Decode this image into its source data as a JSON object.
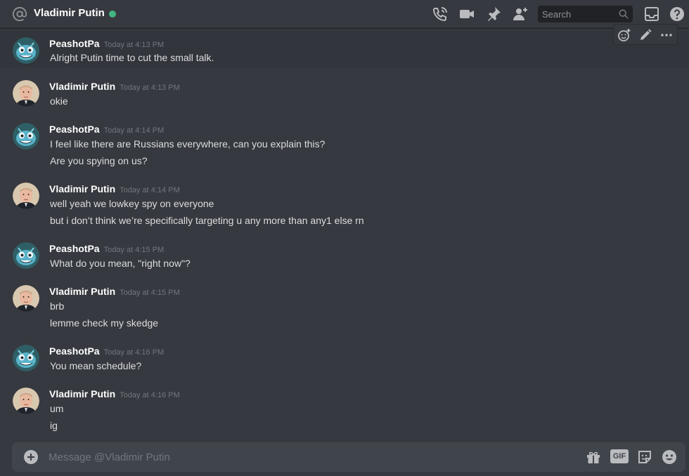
{
  "header": {
    "title": "Vladimir Putin",
    "status": "online",
    "search_placeholder": "Search",
    "icons": [
      "at-icon",
      "call-icon",
      "video-icon",
      "pin-icon",
      "add-friend-icon",
      "search-icon",
      "inbox-icon",
      "help-icon"
    ]
  },
  "colors": {
    "background": "#36393f",
    "online": "#43b581",
    "composer": "#40444b",
    "search": "#202225"
  },
  "hover_toolbar": {
    "icons": [
      "add-reaction-icon",
      "edit-icon",
      "more-icon"
    ]
  },
  "messages": [
    {
      "author": "PeashotPa",
      "avatar": "peashot-avatar",
      "time": "Today at 4:13 PM",
      "lines": [
        "Alright Putin time to cut the small talk."
      ]
    },
    {
      "author": "Vladimir Putin",
      "avatar": "putin-avatar",
      "time": "Today at 4:13 PM",
      "lines": [
        "okie"
      ]
    },
    {
      "author": "PeashotPa",
      "avatar": "peashot-avatar",
      "time": "Today at 4:14 PM",
      "lines": [
        "I feel like there are Russians everywhere, can you explain this?",
        "Are you spying on us?"
      ]
    },
    {
      "author": "Vladimir Putin",
      "avatar": "putin-avatar",
      "time": "Today at 4:14 PM",
      "lines": [
        "well yeah we lowkey spy on everyone",
        "but i don’t think we’re specifically targeting u any more than any1 else rn"
      ]
    },
    {
      "author": "PeashotPa",
      "avatar": "peashot-avatar",
      "time": "Today at 4:15 PM",
      "lines": [
        "What do you mean, \"right now\"?"
      ]
    },
    {
      "author": "Vladimir Putin",
      "avatar": "putin-avatar",
      "time": "Today at 4:15 PM",
      "lines": [
        "brb",
        "lemme check my skedge"
      ]
    },
    {
      "author": "PeashotPa",
      "avatar": "peashot-avatar",
      "time": "Today at 4:16 PM",
      "lines": [
        "You mean schedule?"
      ]
    },
    {
      "author": "Vladimir Putin",
      "avatar": "putin-avatar",
      "time": "Today at 4:16 PM",
      "lines": [
        "um",
        "ig"
      ]
    }
  ],
  "composer": {
    "placeholder": "Message @Vladimir Putin",
    "icons": [
      "add-attachment-icon",
      "gift-icon",
      "gif-icon",
      "sticker-icon",
      "emoji-icon"
    ],
    "gif_label": "GIF"
  }
}
